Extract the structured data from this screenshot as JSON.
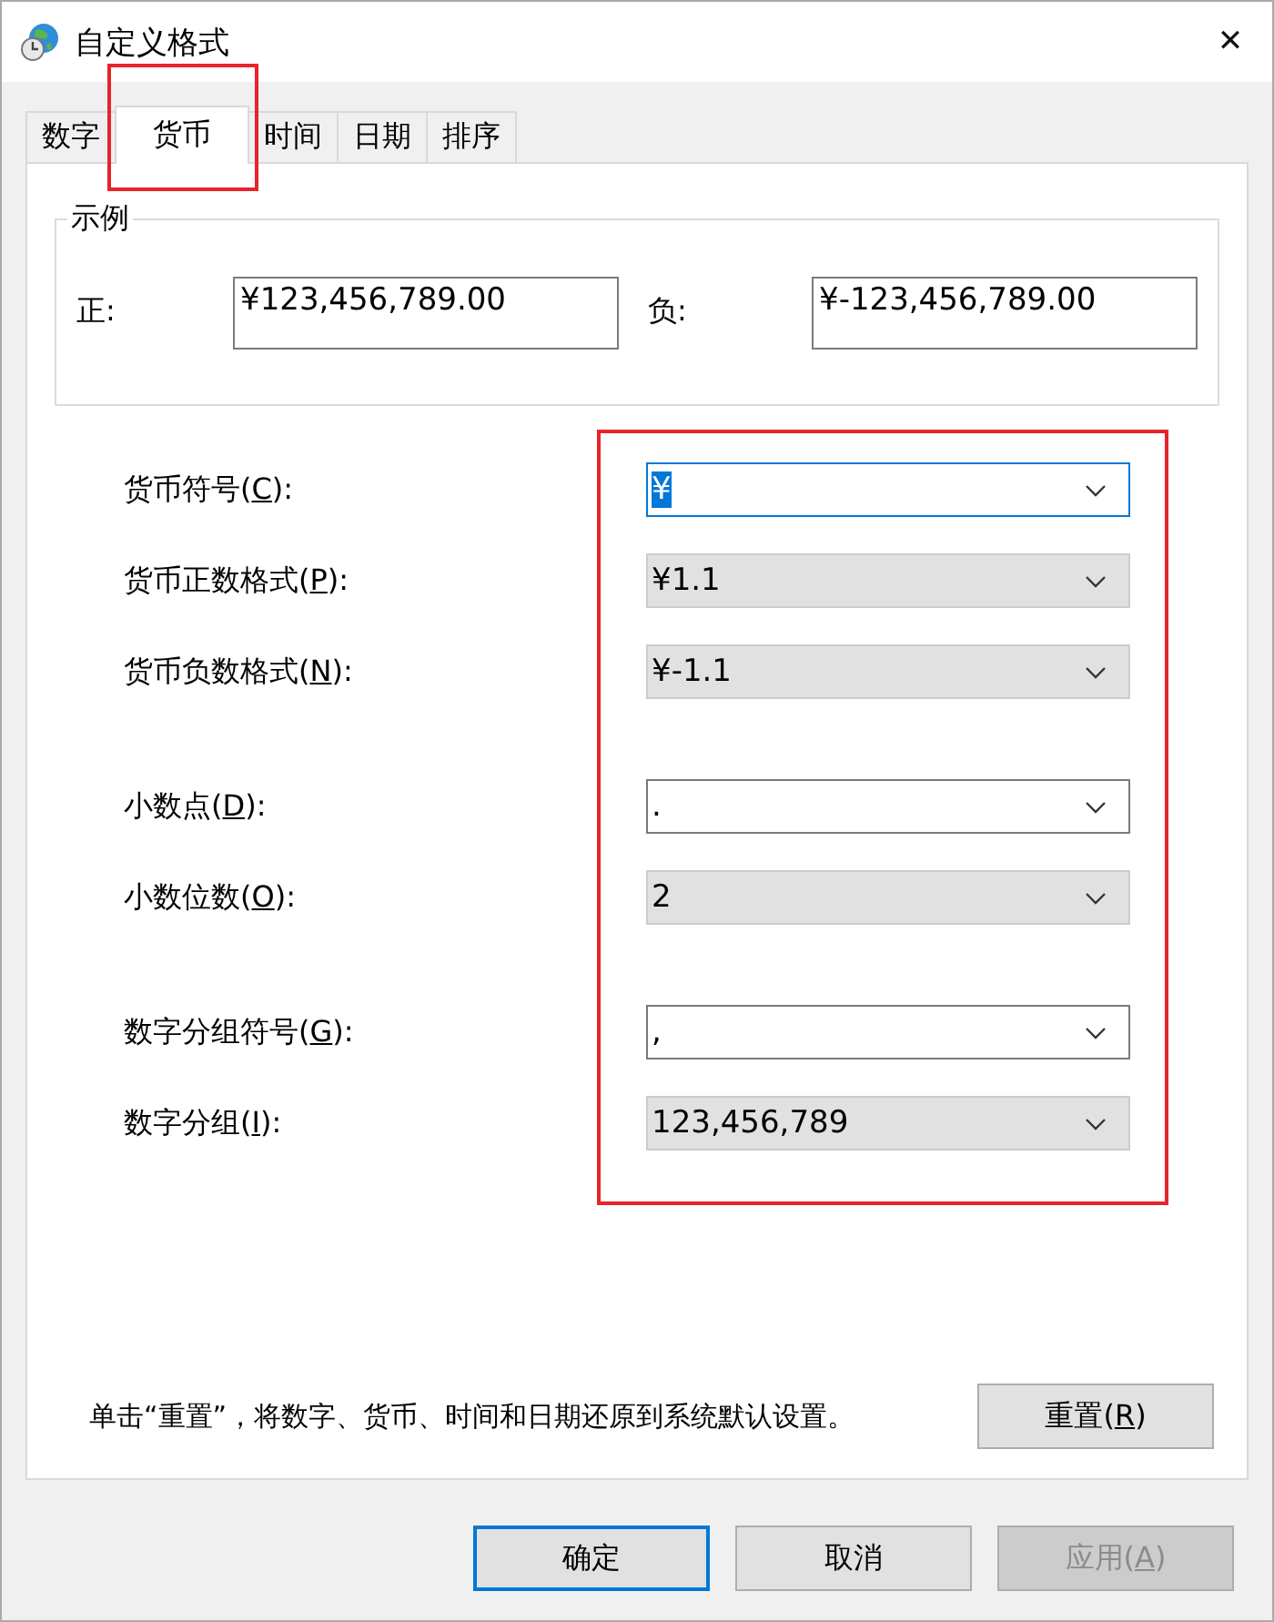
{
  "window": {
    "title": "自定义格式",
    "close": "✕"
  },
  "tabs": [
    {
      "label": "数字",
      "selected": false,
      "highlighted": false
    },
    {
      "label": "货币",
      "selected": true,
      "highlighted": true
    },
    {
      "label": "时间",
      "selected": false,
      "highlighted": false
    },
    {
      "label": "日期",
      "selected": false,
      "highlighted": false
    },
    {
      "label": "排序",
      "selected": false,
      "highlighted": false
    }
  ],
  "example": {
    "title": "示例",
    "positive_label": "正:",
    "positive_value": "¥123,456,789.00",
    "negative_label": "负:",
    "negative_value": "¥-123,456,789.00"
  },
  "settings": {
    "highlighted": true,
    "groups": [
      [
        {
          "label_before": "货币符号(",
          "access_key": "C",
          "label_after": "):",
          "value": "¥",
          "kind": "editable",
          "focused": true
        },
        {
          "label_before": "货币正数格式(",
          "access_key": "P",
          "label_after": "):",
          "value": "¥1.1",
          "kind": "list",
          "focused": false
        },
        {
          "label_before": "货币负数格式(",
          "access_key": "N",
          "label_after": "):",
          "value": "¥-1.1",
          "kind": "list",
          "focused": false
        }
      ],
      [
        {
          "label_before": "小数点(",
          "access_key": "D",
          "label_after": "):",
          "value": ".",
          "kind": "editable",
          "focused": false
        },
        {
          "label_before": "小数位数(",
          "access_key": "O",
          "label_after": "):",
          "value": "2",
          "kind": "list",
          "focused": false
        }
      ],
      [
        {
          "label_before": "数字分组符号(",
          "access_key": "G",
          "label_after": "):",
          "value": ",",
          "kind": "editable",
          "focused": false
        },
        {
          "label_before": "数字分组(",
          "access_key": "I",
          "label_after": "):",
          "value": "123,456,789",
          "kind": "list",
          "focused": false
        }
      ]
    ]
  },
  "reset": {
    "note": "单击“重置”，将数字、货币、时间和日期还原到系统默认设置。",
    "button_before": "重置(",
    "button_key": "R",
    "button_after": ")"
  },
  "buttons": [
    {
      "label_before": "确定",
      "default": true,
      "disabled": false
    },
    {
      "label_before": "取消",
      "default": false,
      "disabled": false
    },
    {
      "label_before": "应用(",
      "key": "A",
      "label_after": ")",
      "default": false,
      "disabled": true
    }
  ]
}
